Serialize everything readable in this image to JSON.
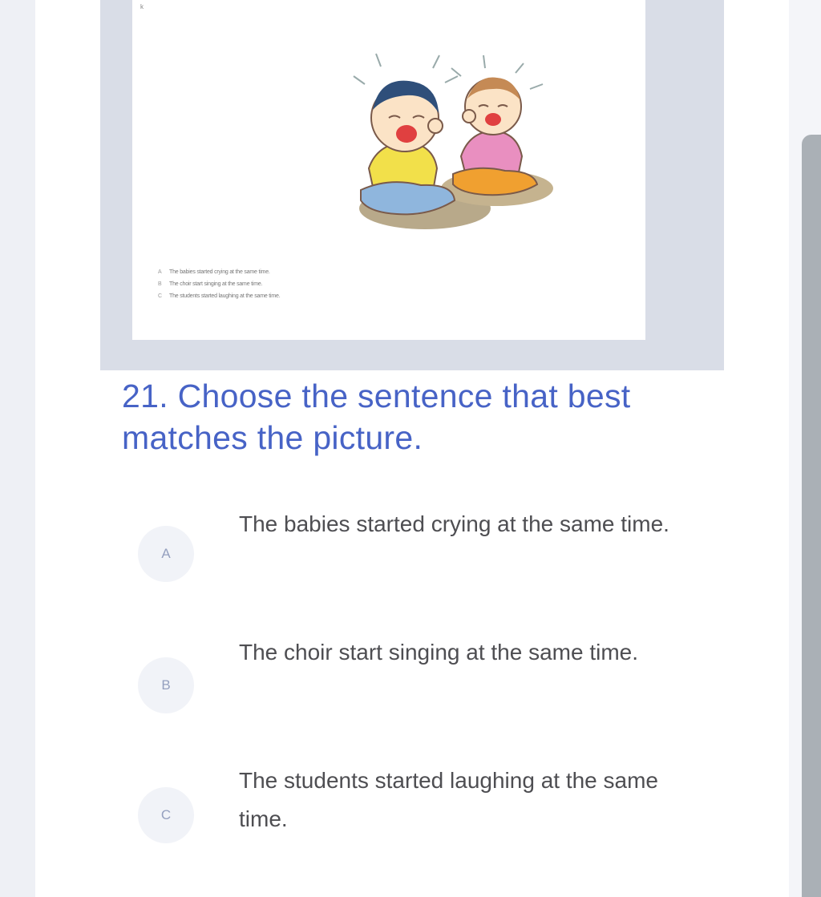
{
  "image": {
    "corner_mark": "k",
    "mini_options": [
      {
        "letter": "A",
        "text": "The babies started crying at the same time."
      },
      {
        "letter": "B",
        "text": "The choir start singing at the same time."
      },
      {
        "letter": "C",
        "text": "The students started laughing at the same time."
      }
    ]
  },
  "question": {
    "title": "21. Choose the sentence that best matches the picture."
  },
  "options": [
    {
      "letter": "A",
      "text": "The babies started crying at the same time."
    },
    {
      "letter": "B",
      "text": "The choir start singing at the same time."
    },
    {
      "letter": "C",
      "text": "The students started laughing at the same time."
    }
  ],
  "colors": {
    "title": "#4763c6",
    "badge_bg": "#f1f3f8",
    "badge_text": "#95a0bf",
    "option_text": "#4e4e52",
    "frame": "#d9dde7",
    "scrollbar": "#aab0b6"
  }
}
